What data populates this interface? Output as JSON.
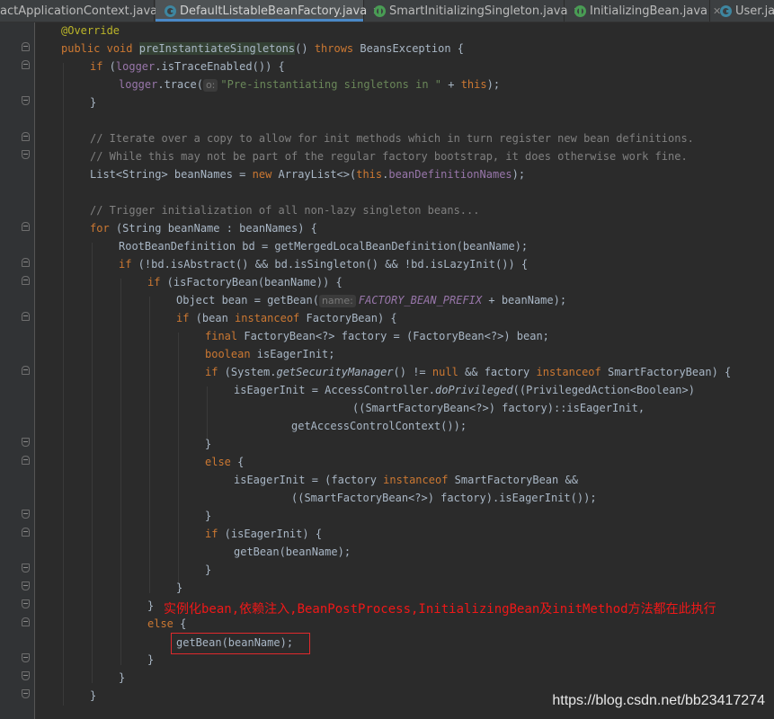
{
  "tabs": [
    {
      "label": "actApplicationContext.java",
      "icon": "none",
      "active": false
    },
    {
      "label": "DefaultListableBeanFactory.java",
      "icon": "class-icon",
      "active": true
    },
    {
      "label": "SmartInitializingSingleton.java",
      "icon": "interface-icon",
      "active": false
    },
    {
      "label": "InitializingBean.java",
      "icon": "interface-icon",
      "active": false
    },
    {
      "label": "User.java",
      "icon": "class-icon",
      "active": false
    }
  ],
  "tab_close_glyph": "✕",
  "colors": {
    "background": "#2b2b2b",
    "keyword": "#cc7832",
    "annotation": "#bbb529",
    "comment": "#808080",
    "string": "#6a8759",
    "field": "#9876aa",
    "annotation_text": "#f01818"
  },
  "code": {
    "annotation_override": "@Override",
    "method_signature": {
      "mod": "public",
      "type": "void",
      "name": "preInstantiateSingletons",
      "params": "()",
      "throws": "throws",
      "exc": "BeansException {"
    },
    "l3": {
      "kw": "if",
      "a": " (",
      "logger": "logger",
      "b": ".isTraceEnabled()) {"
    },
    "l4": {
      "logger": "logger",
      "a": ".trace(",
      "hint": "o:",
      "str": "\"Pre-instantiating singletons in \"",
      "b": " + ",
      "this": "this",
      "c": ");"
    },
    "l5": "}",
    "c1": "// Iterate over a copy to allow for init methods which in turn register new bean definitions.",
    "c2": "// While this may not be part of the regular factory bootstrap, it does otherwise work fine.",
    "l9": {
      "a": "List<String> beanNames = ",
      "new": "new",
      "b": " ArrayList<>(",
      "this": "this",
      "dot": ".",
      "field": "beanDefinitionNames",
      "c": ");"
    },
    "c3": "// Trigger initialization of all non-lazy singleton beans...",
    "l12": {
      "kw": "for",
      "a": " (String beanName : beanNames) {"
    },
    "l13": "RootBeanDefinition bd = getMergedLocalBeanDefinition(beanName);",
    "l14": {
      "kw": "if",
      "a": " (!bd.isAbstract() && bd.isSingleton() && !bd.isLazyInit()) {"
    },
    "l15": {
      "kw": "if",
      "a": " (isFactoryBean(beanName)) {"
    },
    "l16": {
      "a": "Object bean = getBean(",
      "hint": "name:",
      "const": "FACTORY_BEAN_PREFIX",
      "b": " + beanName);"
    },
    "l17": {
      "kw": "if",
      "a": " (bean ",
      "kw2": "instanceof",
      "b": " FactoryBean) {"
    },
    "l18": {
      "kw": "final",
      "a": " FactoryBean<?> factory = (FactoryBean<?>) bean;"
    },
    "l19": {
      "kw": "boolean",
      "a": " isEagerInit;"
    },
    "l20": {
      "kw": "if",
      "a": " (System.",
      "m": "getSecurityManager",
      "b": "() != ",
      "null": "null",
      "c": " && factory ",
      "kw2": "instanceof",
      "d": " SmartFactoryBean) {"
    },
    "l21": {
      "a": "isEagerInit = AccessController.",
      "m": "doPrivileged",
      "b": "((PrivilegedAction<Boolean>)"
    },
    "l22": "((SmartFactoryBean<?>) factory)::isEagerInit,",
    "l23": "getAccessControlContext());",
    "l24": "}",
    "l25": {
      "kw": "else",
      "a": " {"
    },
    "l26": {
      "a": "isEagerInit = (factory ",
      "kw": "instanceof",
      "b": " SmartFactoryBean &&"
    },
    "l27": "((SmartFactoryBean<?>) factory).isEagerInit());",
    "l28": "}",
    "l29": {
      "kw": "if",
      "a": " (isEagerInit) {"
    },
    "l30": "getBean(beanName);",
    "l31": "}",
    "l32": "}",
    "l33": "}",
    "l34": {
      "kw": "else",
      "a": " {"
    },
    "l35": "getBean(beanName);",
    "l36": "}",
    "l37": "}",
    "l38": "}"
  },
  "annotation_note": "实例化bean,依赖注入,BeanPostProcess,InitializingBean及initMethod方法都在此执行",
  "watermark": "https://blog.csdn.net/bb23417274"
}
